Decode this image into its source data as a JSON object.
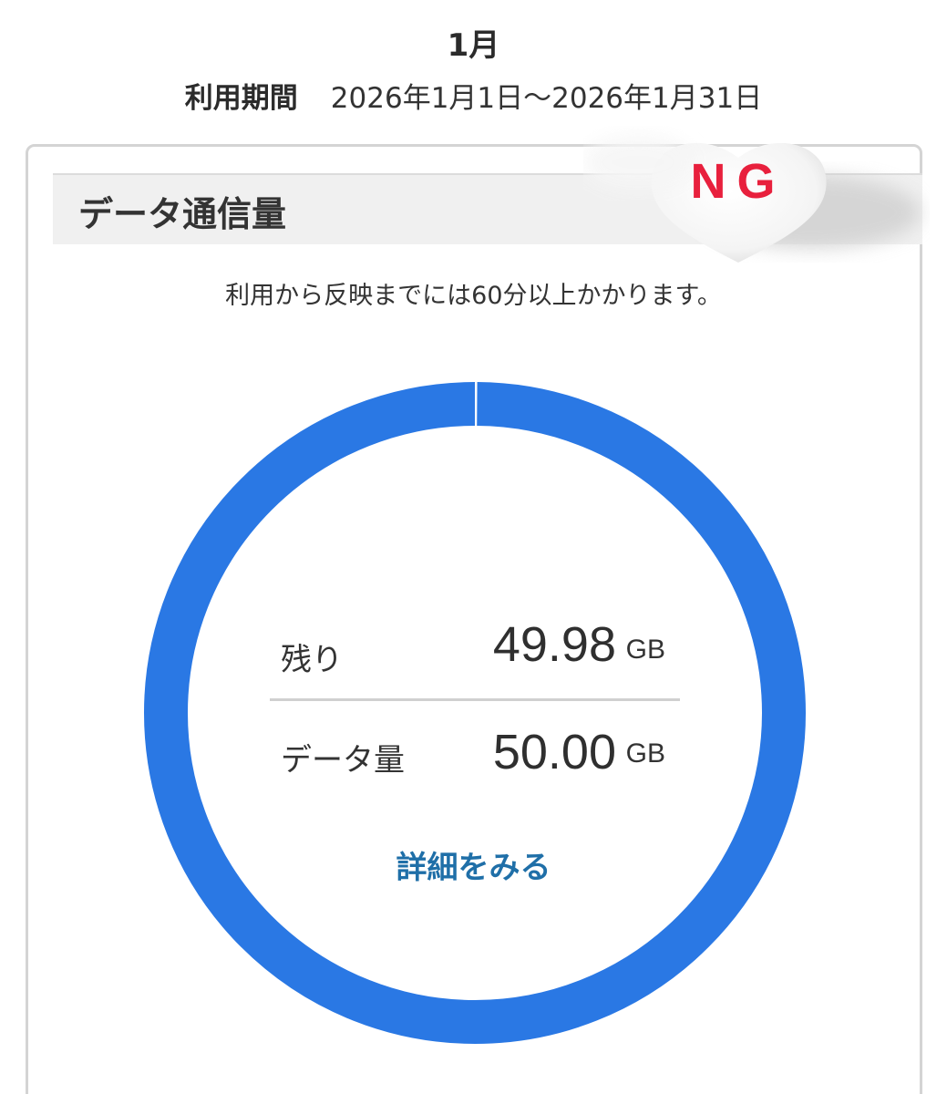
{
  "header": {
    "month": "1月",
    "period_label": "利用期間",
    "period_range": "2026年1月1日〜2026年1月31日"
  },
  "section": {
    "title": "データ通信量",
    "badge_text": "NG",
    "note": "利用から反映までには60分以上かかります。"
  },
  "usage": {
    "remaining_label": "残り",
    "remaining_value": "49.98",
    "remaining_unit": "GB",
    "total_label": "データ量",
    "total_value": "50.00",
    "total_unit": "GB",
    "remaining_fraction": 0.9996,
    "detail_link": "詳細をみる"
  },
  "colors": {
    "ring": "#2a78e4",
    "link": "#1f6fa8",
    "badge": "#e8203d"
  }
}
